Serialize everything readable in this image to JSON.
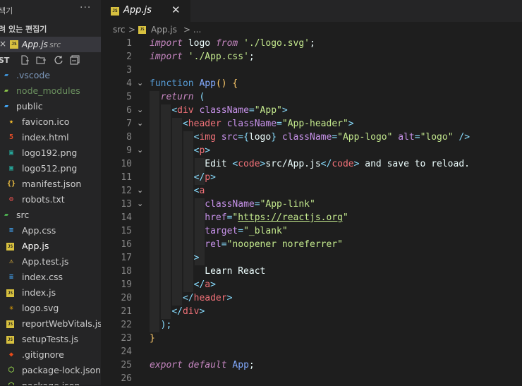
{
  "sidebar": {
    "header_title": "색기",
    "more_label": "···",
    "open_editors_label": "려 있는 편집기",
    "open_editor": {
      "name": "App.js",
      "dir": "src",
      "close": "×"
    },
    "project_label": "ST",
    "actions": [
      "new-file-icon",
      "new-folder-icon",
      "refresh-icon",
      "collapse-icon"
    ],
    "tree": [
      {
        "label": ".vscode",
        "type": "folder",
        "icon": "vscode-folder-icon",
        "color": "#7a95b8"
      },
      {
        "label": "node_modules",
        "type": "folder",
        "icon": "node-folder-icon",
        "color": "#6a8f5e"
      },
      {
        "label": "public",
        "type": "folder",
        "icon": "public-folder-icon",
        "color": "#cccccc"
      },
      {
        "label": "favicon.ico",
        "type": "file",
        "icon": "star-icon",
        "color": "#cccccc"
      },
      {
        "label": "index.html",
        "type": "file",
        "icon": "html-icon",
        "color": "#cccccc"
      },
      {
        "label": "logo192.png",
        "type": "file",
        "icon": "image-icon",
        "color": "#cccccc"
      },
      {
        "label": "logo512.png",
        "type": "file",
        "icon": "image-icon",
        "color": "#cccccc"
      },
      {
        "label": "manifest.json",
        "type": "file",
        "icon": "json-icon",
        "color": "#cccccc"
      },
      {
        "label": "robots.txt",
        "type": "file",
        "icon": "robot-icon",
        "color": "#cccccc"
      },
      {
        "label": "src",
        "type": "folder",
        "icon": "src-folder-icon",
        "color": "#cccccc"
      },
      {
        "label": "App.css",
        "type": "file",
        "icon": "css-icon",
        "color": "#cccccc"
      },
      {
        "label": "App.js",
        "type": "file",
        "icon": "js-icon",
        "color": "#ffffff"
      },
      {
        "label": "App.test.js",
        "type": "file",
        "icon": "test-icon",
        "color": "#cccccc"
      },
      {
        "label": "index.css",
        "type": "file",
        "icon": "css-icon",
        "color": "#cccccc"
      },
      {
        "label": "index.js",
        "type": "file",
        "icon": "js-icon",
        "color": "#cccccc"
      },
      {
        "label": "logo.svg",
        "type": "file",
        "icon": "svg-icon",
        "color": "#cccccc"
      },
      {
        "label": "reportWebVitals.js",
        "type": "file",
        "icon": "js-icon",
        "color": "#cccccc"
      },
      {
        "label": "setupTests.js",
        "type": "file",
        "icon": "js-icon",
        "color": "#cccccc"
      },
      {
        "label": ".gitignore",
        "type": "file",
        "icon": "git-icon",
        "color": "#cccccc"
      },
      {
        "label": "package-lock.json",
        "type": "file",
        "icon": "npm-icon",
        "color": "#cccccc"
      },
      {
        "label": "package.json",
        "type": "file",
        "icon": "npm-icon",
        "color": "#cccccc"
      }
    ]
  },
  "tab": {
    "label": "App.js",
    "icon_text": "JS",
    "close": "✕"
  },
  "breadcrumb": {
    "folder": "src",
    "sep": ">",
    "file": "App.js",
    "tail": "> ..."
  },
  "editor": {
    "line_numbers": [
      "1",
      "2",
      "3",
      "4",
      "5",
      "6",
      "7",
      "8",
      "9",
      "10",
      "11",
      "12",
      "13",
      "14",
      "15",
      "16",
      "17",
      "18",
      "19",
      "20",
      "21",
      "22",
      "23",
      "24",
      "25",
      "26"
    ],
    "folds": {
      "4": "⌄",
      "6": "⌄",
      "7": "⌄",
      "9": "⌄",
      "12": "⌄",
      "13": "⌄"
    },
    "lines": [
      [
        [
          "k",
          "import"
        ],
        [
          "w",
          " logo "
        ],
        [
          "k",
          "from"
        ],
        [
          "w",
          " "
        ],
        [
          "s2",
          "'./logo.svg'"
        ],
        [
          "w",
          ";"
        ]
      ],
      [
        [
          "k",
          "import"
        ],
        [
          "w",
          " "
        ],
        [
          "s2",
          "'./App.css'"
        ],
        [
          "w",
          ";"
        ]
      ],
      [],
      [
        [
          "kb",
          "function"
        ],
        [
          "w",
          " "
        ],
        [
          "fn",
          "App"
        ],
        [
          "y",
          "()"
        ],
        [
          "w",
          " "
        ],
        [
          "y",
          "{"
        ]
      ],
      [
        [
          "w",
          "  "
        ],
        [
          "k",
          "return"
        ],
        [
          "w",
          " "
        ],
        [
          "p",
          "("
        ]
      ],
      [
        [
          "w",
          "    "
        ],
        [
          "p",
          "<"
        ],
        [
          "t",
          "div"
        ],
        [
          "w",
          " "
        ],
        [
          "a",
          "className"
        ],
        [
          "p",
          "="
        ],
        [
          "s2",
          "\"App\""
        ],
        [
          "p",
          ">"
        ]
      ],
      [
        [
          "w",
          "      "
        ],
        [
          "p",
          "<"
        ],
        [
          "t",
          "header"
        ],
        [
          "w",
          " "
        ],
        [
          "a",
          "className"
        ],
        [
          "p",
          "="
        ],
        [
          "s2",
          "\"App-header\""
        ],
        [
          "p",
          ">"
        ]
      ],
      [
        [
          "w",
          "        "
        ],
        [
          "p",
          "<"
        ],
        [
          "t",
          "img"
        ],
        [
          "w",
          " "
        ],
        [
          "a",
          "src"
        ],
        [
          "p",
          "={"
        ],
        [
          "w",
          "logo"
        ],
        [
          "p",
          "}"
        ],
        [
          "w",
          " "
        ],
        [
          "a",
          "className"
        ],
        [
          "p",
          "="
        ],
        [
          "s2",
          "\"App-logo\""
        ],
        [
          "w",
          " "
        ],
        [
          "a",
          "alt"
        ],
        [
          "p",
          "="
        ],
        [
          "s2",
          "\"logo\""
        ],
        [
          "w",
          " "
        ],
        [
          "p",
          "/>"
        ]
      ],
      [
        [
          "w",
          "        "
        ],
        [
          "p",
          "<"
        ],
        [
          "t",
          "p"
        ],
        [
          "p",
          ">"
        ]
      ],
      [
        [
          "w",
          "          Edit "
        ],
        [
          "p",
          "<"
        ],
        [
          "t",
          "code"
        ],
        [
          "p",
          ">"
        ],
        [
          "w",
          "src/App.js"
        ],
        [
          "p",
          "</"
        ],
        [
          "t",
          "code"
        ],
        [
          "p",
          ">"
        ],
        [
          "w",
          " and save to reload."
        ]
      ],
      [
        [
          "w",
          "        "
        ],
        [
          "p",
          "</"
        ],
        [
          "t",
          "p"
        ],
        [
          "p",
          ">"
        ]
      ],
      [
        [
          "w",
          "        "
        ],
        [
          "p",
          "<"
        ],
        [
          "t",
          "a"
        ]
      ],
      [
        [
          "w",
          "          "
        ],
        [
          "a",
          "className"
        ],
        [
          "p",
          "="
        ],
        [
          "s2",
          "\"App-link\""
        ]
      ],
      [
        [
          "w",
          "          "
        ],
        [
          "a",
          "href"
        ],
        [
          "p",
          "="
        ],
        [
          "s2",
          "\""
        ],
        [
          "s2 u",
          "https://reactjs.org"
        ],
        [
          "s2",
          "\""
        ]
      ],
      [
        [
          "w",
          "          "
        ],
        [
          "a",
          "target"
        ],
        [
          "p",
          "="
        ],
        [
          "s2",
          "\"_blank\""
        ]
      ],
      [
        [
          "w",
          "          "
        ],
        [
          "a",
          "rel"
        ],
        [
          "p",
          "="
        ],
        [
          "s2",
          "\"noopener noreferrer\""
        ]
      ],
      [
        [
          "w",
          "        "
        ],
        [
          "p",
          ">"
        ]
      ],
      [
        [
          "w",
          "          Learn React"
        ]
      ],
      [
        [
          "w",
          "        "
        ],
        [
          "p",
          "</"
        ],
        [
          "t",
          "a"
        ],
        [
          "p",
          ">"
        ]
      ],
      [
        [
          "w",
          "      "
        ],
        [
          "p",
          "</"
        ],
        [
          "t",
          "header"
        ],
        [
          "p",
          ">"
        ]
      ],
      [
        [
          "w",
          "    "
        ],
        [
          "p",
          "</"
        ],
        [
          "t",
          "div"
        ],
        [
          "p",
          ">"
        ]
      ],
      [
        [
          "w",
          "  "
        ],
        [
          "p",
          ");"
        ]
      ],
      [
        [
          "y",
          "}"
        ]
      ],
      [],
      [
        [
          "k",
          "export"
        ],
        [
          "w",
          " "
        ],
        [
          "k",
          "default"
        ],
        [
          "w",
          " "
        ],
        [
          "fn",
          "App"
        ],
        [
          "w",
          ";"
        ]
      ],
      []
    ]
  }
}
